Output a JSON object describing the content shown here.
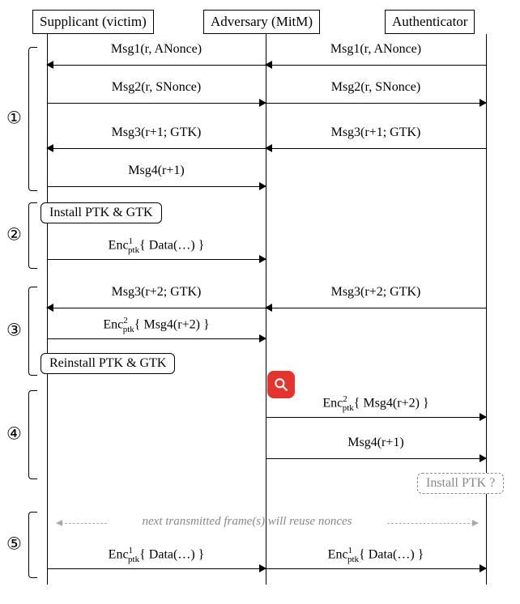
{
  "participants": {
    "supplicant": "Supplicant (victim)",
    "adversary": "Adversary (MitM)",
    "authenticator": "Authenticator"
  },
  "messages": {
    "msg1": "Msg1(r, ANonce)",
    "msg2": "Msg2(r, SNonce)",
    "msg3a": "Msg3(r+1; GTK)",
    "msg4a": "Msg4(r+1)",
    "msg3b": "Msg3(r+2; GTK)",
    "encData": "Enc",
    "encDataArg": "{ Data(…) }",
    "encMsg4Arg": "{ Msg4(r+2) }",
    "msg4b": "Msg4(r+1)"
  },
  "notes": {
    "installPTKGTK": "Install PTK & GTK",
    "reinstallPTKGTK": "Reinstall PTK & GTK",
    "installPTKQ": "Install PTK ?"
  },
  "annotation": "next transmitted frame(s) will reuse nonces",
  "steps": {
    "s1": "①",
    "s2": "②",
    "s3": "③",
    "s4": "④",
    "s5": "⑤"
  }
}
